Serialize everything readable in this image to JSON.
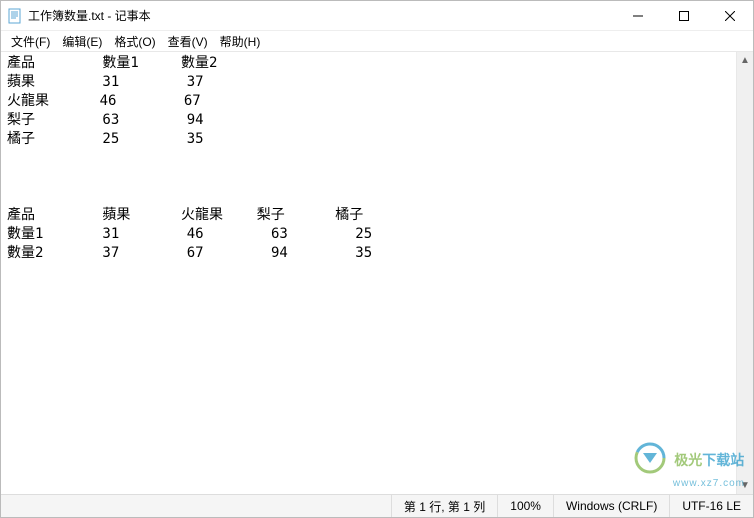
{
  "window": {
    "title": "工作簿数量.txt - 记事本"
  },
  "menu": {
    "file": "文件(F)",
    "edit": "编辑(E)",
    "format": "格式(O)",
    "view": "查看(V)",
    "help": "帮助(H)"
  },
  "text": {
    "block1": {
      "headers": [
        "產品",
        "數量1",
        "數量2"
      ],
      "rows": [
        {
          "name": "蘋果",
          "v1": "31",
          "v2": "37"
        },
        {
          "name": "火龍果",
          "v1": "46",
          "v2": "67"
        },
        {
          "name": "梨子",
          "v1": "63",
          "v2": "94"
        },
        {
          "name": "橘子",
          "v1": "25",
          "v2": "35"
        }
      ]
    },
    "block2": {
      "rowlabels": [
        "產品",
        "數量1",
        "數量2"
      ],
      "cols": [
        {
          "name": "蘋果",
          "v1": "31",
          "v2": "37"
        },
        {
          "name": "火龍果",
          "v1": "46",
          "v2": "67"
        },
        {
          "name": "梨子",
          "v1": "63",
          "v2": "94"
        },
        {
          "name": "橘子",
          "v1": "25",
          "v2": "35"
        }
      ]
    }
  },
  "status": {
    "position": "第 1 行, 第 1 列",
    "zoom": "100%",
    "lineend": "Windows (CRLF)",
    "encoding": "UTF-16 LE"
  },
  "watermark": {
    "brand_a": "极光",
    "brand_b": "下载站",
    "sub": "www.xz7.com"
  }
}
